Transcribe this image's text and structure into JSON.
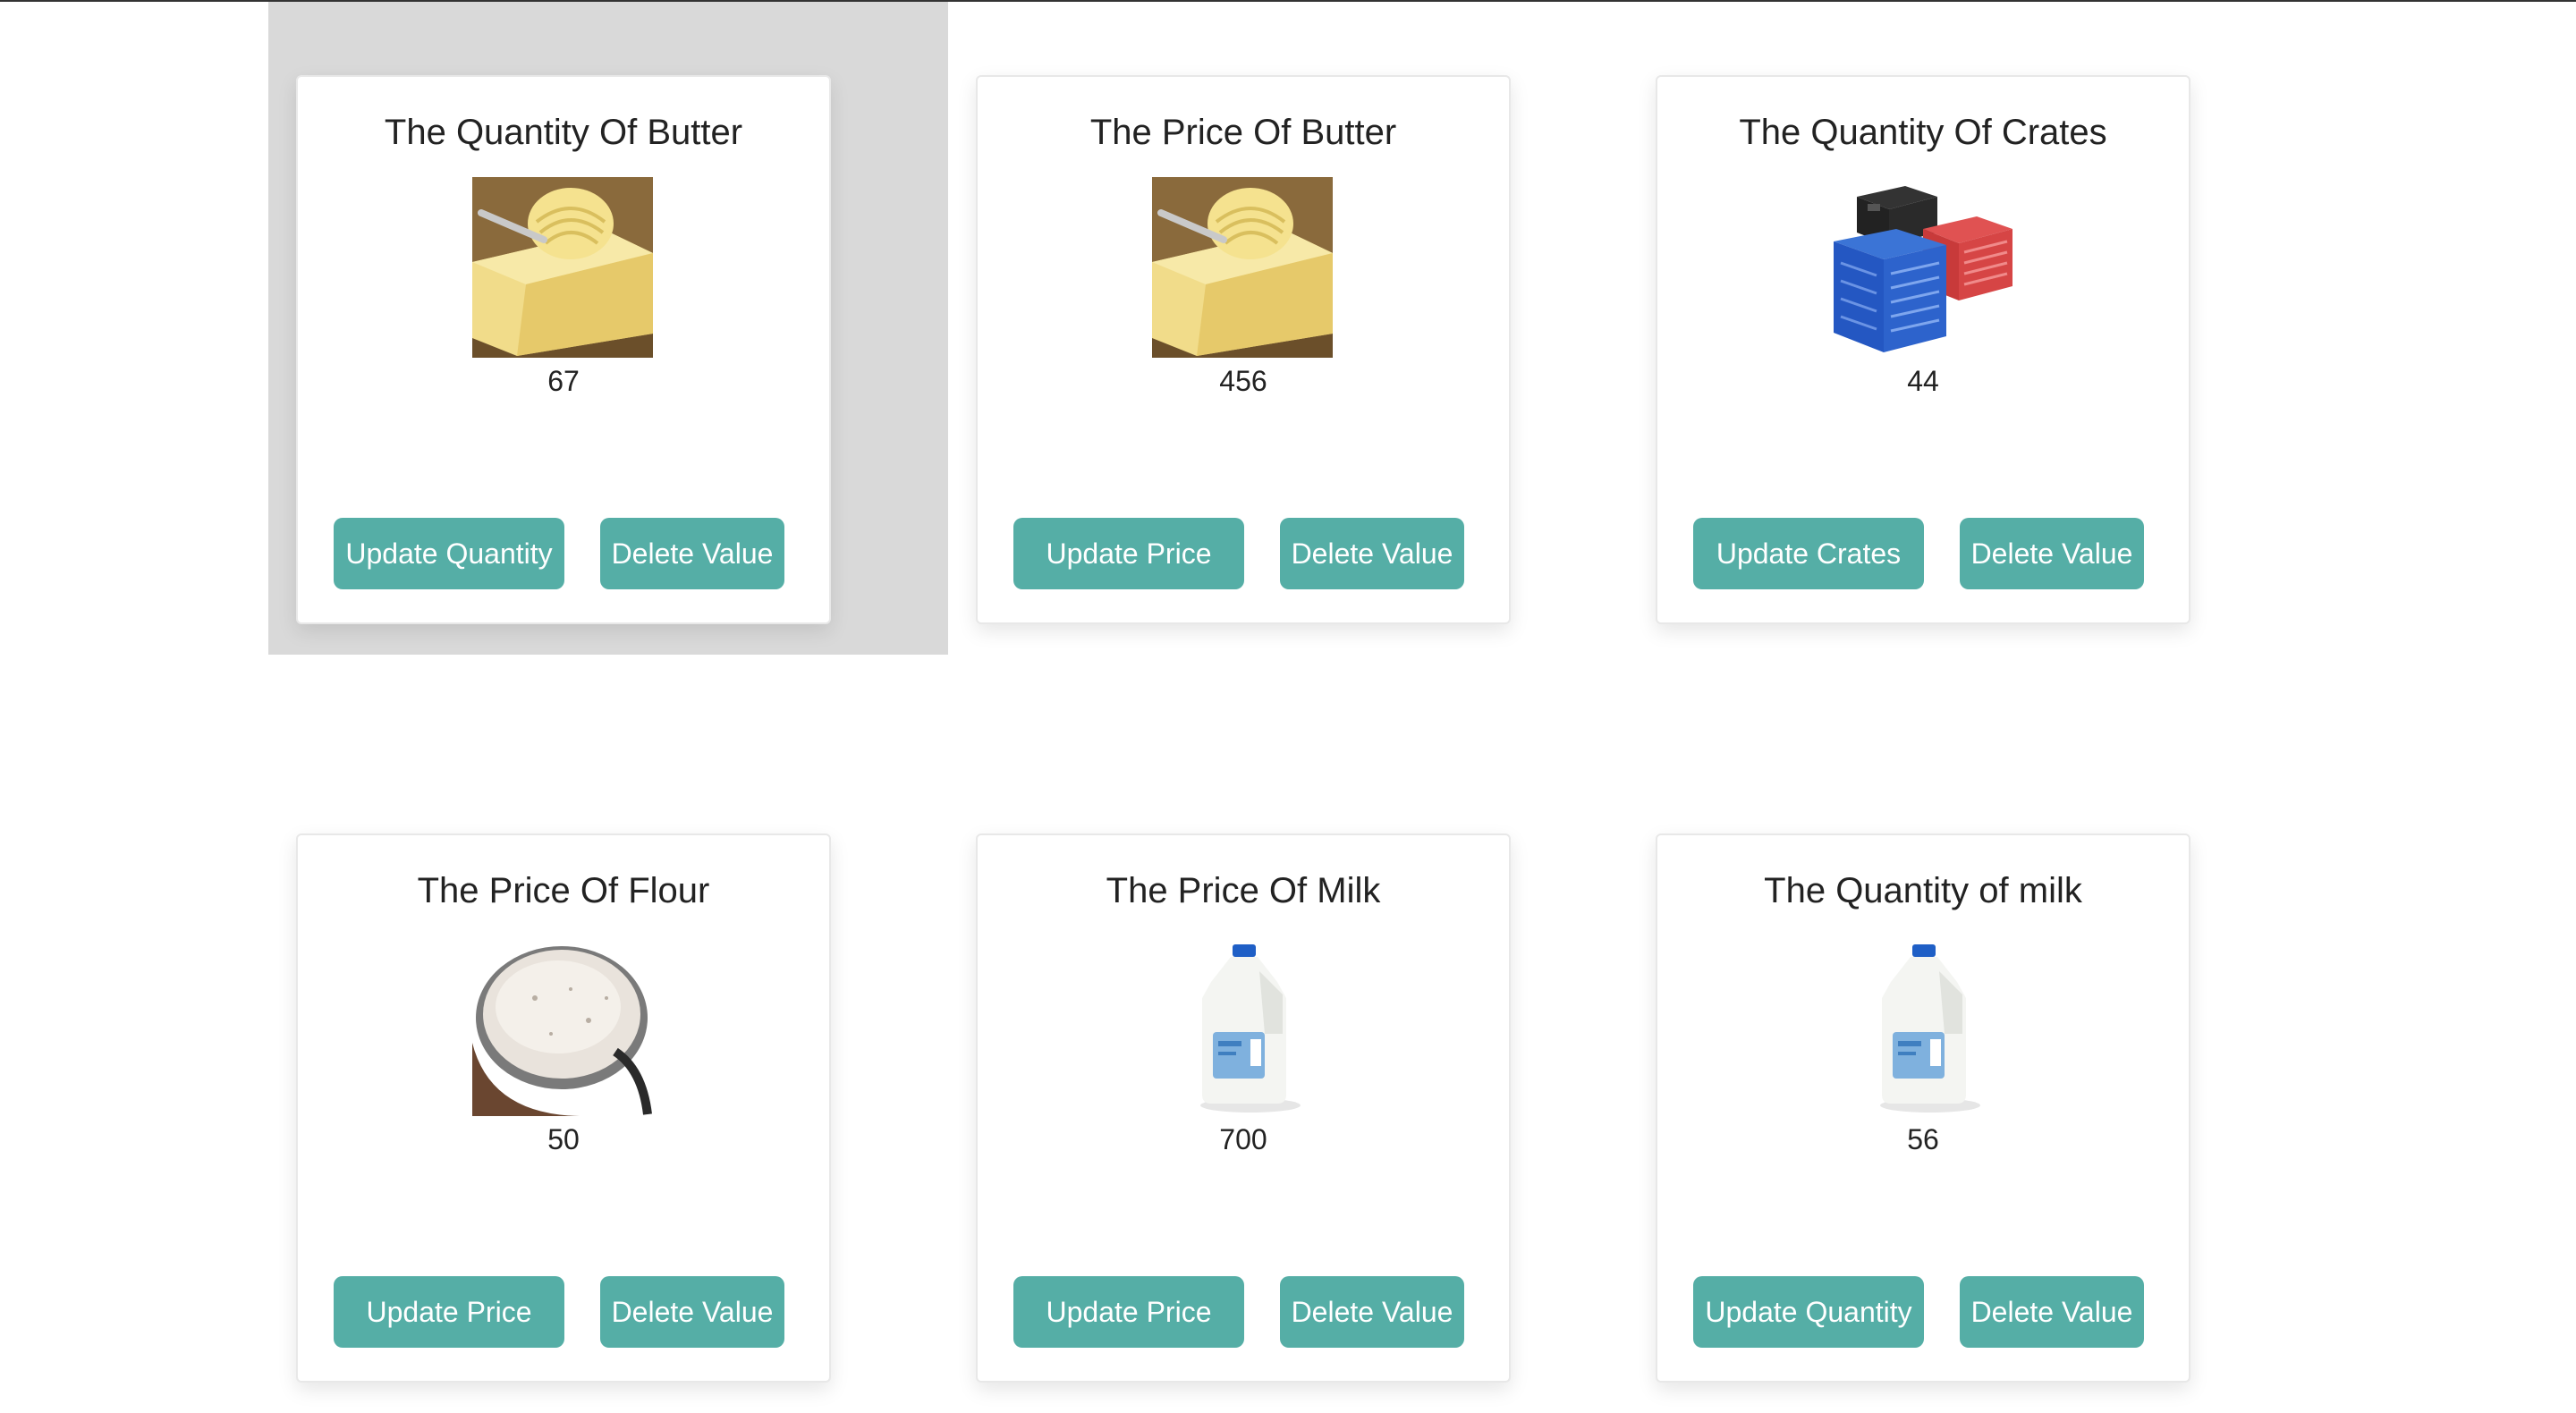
{
  "cards": [
    {
      "title": "The Quantity Of Butter",
      "image": "butter",
      "value": "67",
      "update_label": "Update Quantity",
      "delete_label": "Delete Value"
    },
    {
      "title": "The Price Of Butter",
      "image": "butter",
      "value": "456",
      "update_label": "Update Price",
      "delete_label": "Delete Value"
    },
    {
      "title": "The Quantity Of Crates",
      "image": "crates",
      "value": "44",
      "update_label": "Update Crates",
      "delete_label": "Delete Value"
    },
    {
      "title": "The Price Of Flour",
      "image": "flour",
      "value": "50",
      "update_label": "Update Price",
      "delete_label": "Delete Value"
    },
    {
      "title": "The Price Of Milk",
      "image": "milk",
      "value": "700",
      "update_label": "Update Price",
      "delete_label": "Delete Value"
    },
    {
      "title": "The Quantity of milk",
      "image": "milk",
      "value": "56",
      "update_label": "Update Quantity",
      "delete_label": "Delete Value"
    }
  ],
  "colors": {
    "button": "#55aea6",
    "hover_background": "#d9d9d9"
  }
}
